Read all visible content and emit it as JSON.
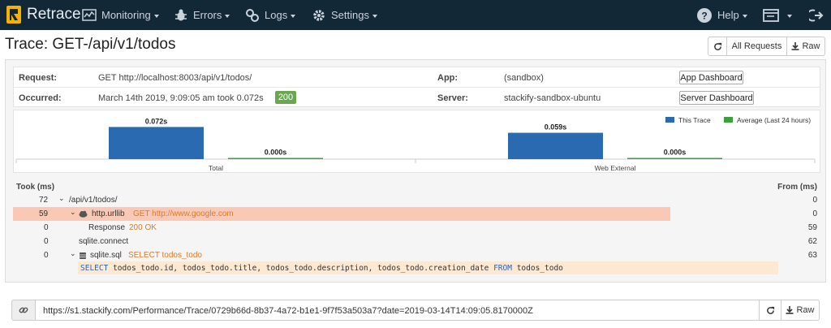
{
  "nav": {
    "brand": "Retrace",
    "items": [
      {
        "label": "Monitoring",
        "icon": "monitoring-icon"
      },
      {
        "label": "Errors",
        "icon": "bug-icon"
      },
      {
        "label": "Logs",
        "icon": "logs-icon"
      },
      {
        "label": "Settings",
        "icon": "gear-icon"
      }
    ],
    "help": "Help"
  },
  "page": {
    "title": "Trace: GET-/api/v1/todos",
    "buttons": {
      "refresh": "",
      "all_requests": "All Requests",
      "raw": "Raw"
    }
  },
  "info": {
    "request_label": "Request:",
    "request_value": "GET http://localhost:8003/api/v1/todos/",
    "app_label": "App:",
    "app_value": "(sandbox)",
    "app_button": "App Dashboard",
    "occurred_label": "Occurred:",
    "occurred_value": "March 14th 2019, 9:09:05 am took 0.072s",
    "status_code": "200",
    "server_label": "Server:",
    "server_value": "stackify-sandbox-ubuntu",
    "server_button": "Server Dashboard"
  },
  "chart_data": {
    "type": "bar",
    "categories": [
      "Total",
      "Web External"
    ],
    "series": [
      {
        "name": "This Trace",
        "values": [
          0.072,
          0.059
        ],
        "labels": [
          "0.072s",
          "0.059s"
        ],
        "color": "#2a6ab0"
      },
      {
        "name": "Average (Last 24 hours)",
        "values": [
          0.0,
          0.0
        ],
        "labels": [
          "0.000s",
          "0.000s"
        ],
        "color": "#3aa23a"
      }
    ],
    "ylim": [
      0,
      0.08
    ],
    "legend": "top-right",
    "grid": false
  },
  "trace": {
    "took_header": "Took (ms)",
    "from_header": "From (ms)",
    "rows": [
      {
        "took": "72",
        "name": "/api/v1/todos/",
        "detail": "",
        "from": "0"
      },
      {
        "took": "59",
        "name": "http.urllib",
        "detail": "GET http://www.google.com",
        "from": "0"
      },
      {
        "took": "0",
        "name": "Response",
        "detail": "200 OK",
        "from": "59"
      },
      {
        "took": "0",
        "name": "sqlite.connect",
        "detail": "",
        "from": "62"
      },
      {
        "took": "0",
        "name": "sqlite.sql",
        "detail": "SELECT todos_todo",
        "from": "63"
      }
    ],
    "sql": {
      "kw1": "SELECT",
      "cols": "todos_todo.id, todos_todo.title, todos_todo.description, todos_todo.creation_date",
      "kw2": "FROM",
      "table": "todos_todo"
    }
  },
  "urlbar": {
    "url": "https://s1.stackify.com/Performance/Trace/0729b66d-8b37-4a72-b1e1-9f7f53a503a7?date=2019-03-14T14:09:05.8170000Z",
    "raw": "Raw"
  }
}
